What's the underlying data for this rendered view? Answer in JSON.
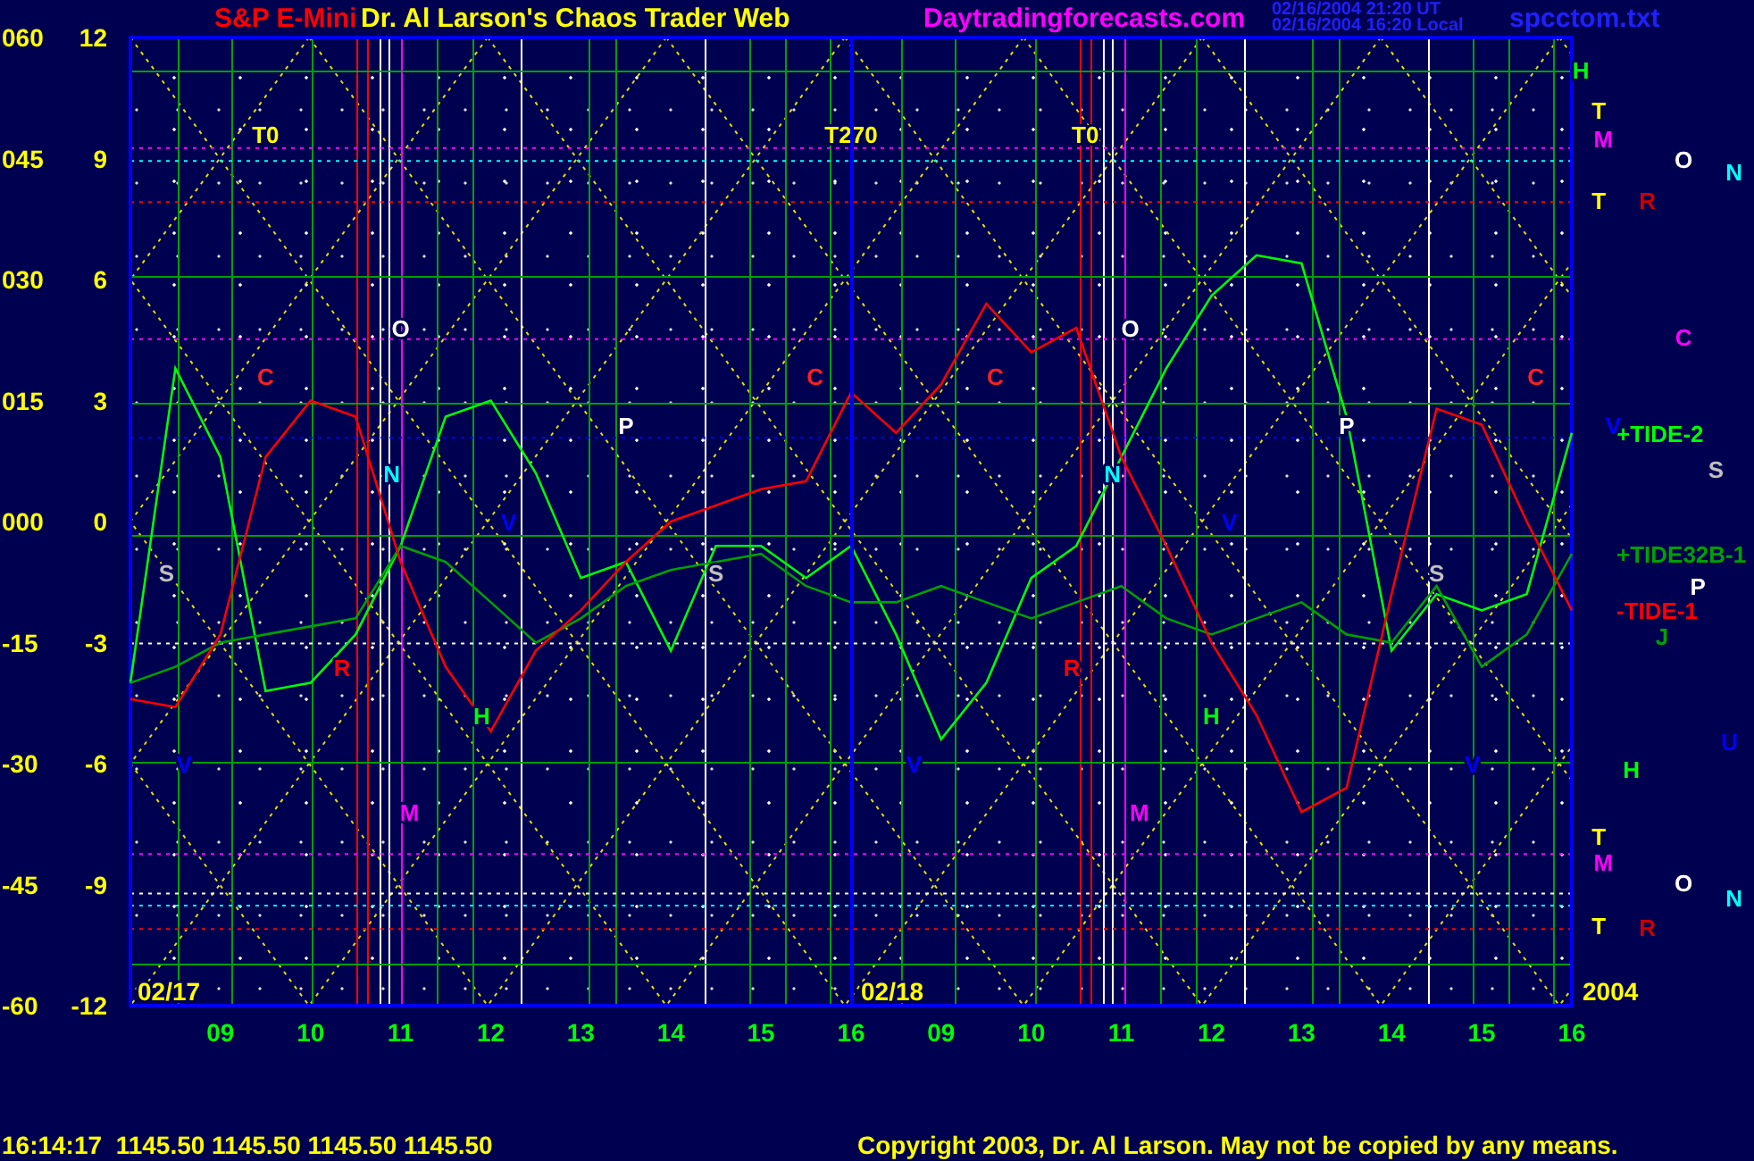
{
  "header": {
    "instrument": "S&P E-Mini",
    "site_title": "Dr. Al Larson's Chaos Trader Web",
    "website": "Daytradingforecasts.com",
    "timestamps": [
      "02/16/2004 21:20 UT",
      "02/16/2004 16:20 Local"
    ],
    "filename": "spcctom.txt"
  },
  "chart": {
    "chart_data": {
      "type": "line",
      "grid": true,
      "ylim": [
        -60,
        60
      ],
      "yticks": [
        {
          "value": 60,
          "label": "060"
        },
        {
          "value": 45,
          "label": "045"
        },
        {
          "value": 30,
          "label": "030"
        },
        {
          "value": 15,
          "label": "015"
        },
        {
          "value": 0,
          "label": "000"
        },
        {
          "value": -15,
          "label": "-15"
        },
        {
          "value": -30,
          "label": "-30"
        },
        {
          "value": -45,
          "label": "-45"
        },
        {
          "value": -60,
          "label": "-60"
        }
      ],
      "ref_lines": [
        {
          "axis": "y",
          "value": 46.3,
          "color": "#ff00ff"
        },
        {
          "axis": "y",
          "value": 44.7,
          "color": "#00ffff"
        },
        {
          "axis": "y",
          "value": 39.6,
          "color": "#ff0000"
        },
        {
          "axis": "y",
          "value": 22.6,
          "color": "#ff00ff"
        },
        {
          "axis": "y",
          "value": 10.4,
          "color": "#0000ff"
        },
        {
          "axis": "y",
          "value": -15.1,
          "color": "#ffffff"
        },
        {
          "axis": "y",
          "value": -41.2,
          "color": "#ff00ff"
        },
        {
          "axis": "y",
          "value": -46.1,
          "color": "#ffffff"
        },
        {
          "axis": "y",
          "value": -47.6,
          "color": "#00ffff"
        },
        {
          "axis": "y",
          "value": -50.5,
          "color": "#ff0000"
        }
      ],
      "series": [
        {
          "name": "+TIDE-2",
          "color": "#00ff00",
          "values": [
            -20,
            19,
            8,
            -21,
            -20,
            -14,
            -3,
            13,
            15,
            6,
            -7,
            -5,
            -16,
            -3,
            -3,
            -7,
            -3,
            -14,
            -27,
            -20,
            -7,
            -3,
            8,
            19,
            28,
            33,
            32,
            13,
            -16,
            -9,
            -11,
            -9,
            11
          ]
        },
        {
          "name": "+TIDE32B-1",
          "color": "#00a000",
          "values": [
            -20,
            -18,
            -15,
            -14,
            -13,
            -12,
            -3,
            -5,
            -10,
            -15,
            -12,
            -8,
            -6,
            -5,
            -4,
            -8,
            -10,
            -10,
            -8,
            -10,
            -12,
            -10,
            -8,
            -12,
            -14,
            -12,
            -10,
            -14,
            -15,
            -8,
            -18,
            -14,
            -4
          ]
        },
        {
          "name": "-TIDE-1",
          "color": "#ff0000",
          "values": [
            -22,
            -23,
            -14,
            8,
            15,
            13,
            -5,
            -18,
            -26,
            -16,
            -11,
            -5,
            0,
            2,
            4,
            5,
            16,
            11,
            17,
            27,
            21,
            24,
            8,
            -3,
            -15,
            -24,
            -36,
            -33,
            -9,
            14,
            12,
            0,
            -11
          ]
        }
      ]
    },
    "x_axis_labels": [
      "09",
      "10",
      "11",
      "12",
      "13",
      "14",
      "15",
      "16",
      "09",
      "10",
      "11",
      "12",
      "13",
      "14",
      "15",
      "16"
    ],
    "scale_labels": [
      "12",
      "9",
      "6",
      "3",
      "0",
      "-3",
      "-6",
      "-9",
      "-12"
    ],
    "markers": [
      {
        "text": "T0",
        "color": "#ffff00"
      },
      {
        "text": "T270",
        "color": "#ffff00"
      },
      {
        "text": "T0",
        "color": "#ffff00"
      },
      {
        "text": "O",
        "color": "#ffffff"
      },
      {
        "text": "O",
        "color": "#ffffff"
      },
      {
        "text": "C",
        "color": "#ff2020"
      },
      {
        "text": "C",
        "color": "#ff2020"
      },
      {
        "text": "C",
        "color": "#ff2020"
      },
      {
        "text": "C",
        "color": "#ff2020"
      },
      {
        "text": "P",
        "color": "#ffffff"
      },
      {
        "text": "P",
        "color": "#ffffff"
      },
      {
        "text": "N",
        "color": "#00ffff"
      },
      {
        "text": "N",
        "color": "#00ffff"
      },
      {
        "text": "V",
        "color": "#0000ff"
      },
      {
        "text": "V",
        "color": "#0000ff"
      },
      {
        "text": "S",
        "color": "#c0c0c0"
      },
      {
        "text": "S",
        "color": "#c0c0c0"
      },
      {
        "text": "S",
        "color": "#c0c0c0"
      },
      {
        "text": "R",
        "color": "#ff0000"
      },
      {
        "text": "R",
        "color": "#ff0000"
      },
      {
        "text": "H",
        "color": "#00ff00"
      },
      {
        "text": "H",
        "color": "#00ff00"
      },
      {
        "text": "V",
        "color": "#0000ff"
      },
      {
        "text": "V",
        "color": "#0000ff"
      },
      {
        "text": "V",
        "color": "#0000ff"
      },
      {
        "text": "M",
        "color": "#ff00ff"
      },
      {
        "text": "M",
        "color": "#ff00ff"
      },
      {
        "text": "H",
        "color": "#00ff00"
      },
      {
        "text": "T",
        "color": "#ffff00"
      },
      {
        "text": "M",
        "color": "#ff00ff"
      },
      {
        "text": "O",
        "color": "#ffffff"
      },
      {
        "text": "N",
        "color": "#00ffff"
      },
      {
        "text": "T",
        "color": "#ffff00"
      },
      {
        "text": "R",
        "color": "#cc0000"
      },
      {
        "text": "C",
        "color": "#ff00ff"
      },
      {
        "text": "V",
        "color": "#0000ff"
      },
      {
        "text": "S",
        "color": "#c0c0c0"
      },
      {
        "text": "P",
        "color": "#ffffff"
      },
      {
        "text": "J",
        "color": "#00a000"
      },
      {
        "text": "U",
        "color": "#0000ff"
      },
      {
        "text": "H",
        "color": "#00ff00"
      },
      {
        "text": "T",
        "color": "#ffff00"
      },
      {
        "text": "M",
        "color": "#ff00ff"
      },
      {
        "text": "O",
        "color": "#ffffff"
      },
      {
        "text": "N",
        "color": "#00ffff"
      },
      {
        "text": "T",
        "color": "#ffff00"
      },
      {
        "text": "R",
        "color": "#cc0000"
      }
    ],
    "date_labels": [
      "02/17",
      "02/18"
    ],
    "year_label": "2004"
  },
  "status_bar": {
    "quote": "16:14:17  1145.50 1145.50 1145.50 1145.50",
    "copyright": "Copyright 2003, Dr. Al Larson. May not be copied by any means."
  }
}
